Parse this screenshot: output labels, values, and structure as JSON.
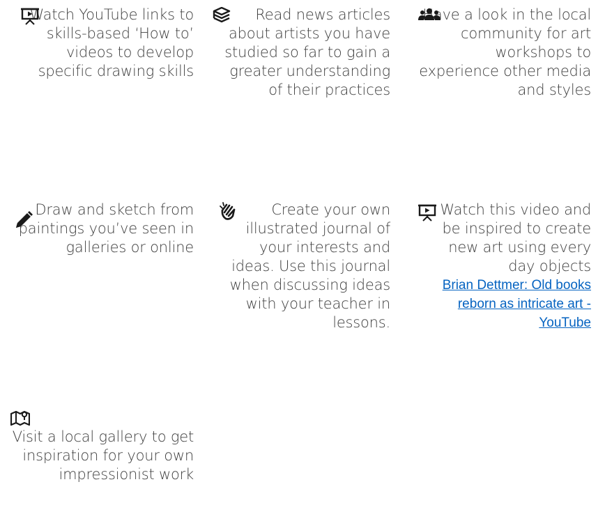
{
  "tiles": [
    {
      "icon": "presentation-screen-icon",
      "text": "Watch YouTube links to skills-based ‘How to’ videos to develop specific drawing skills"
    },
    {
      "icon": "layered-books-icon",
      "text": "Read news articles about artists you have studied so far to gain a greater understanding of their practices"
    },
    {
      "icon": "people-group-icon",
      "text": "Have a look in the local community for art workshops to experience other media and styles"
    },
    {
      "icon": "pencil-icon",
      "text": "Draw and sketch from paintings you’ve seen in galleries or online"
    },
    {
      "icon": "sign-language-hand-icon",
      "text": "Create your own illustrated journal of your interests and ideas. Use this journal when discussing ideas with your teacher in lessons."
    },
    {
      "icon": "presentation-screen-icon",
      "text": "Watch this video and be inspired to create new art using every day objects",
      "link": "Brian Dettmer: Old books reborn as intricate art - YouTube"
    },
    {
      "icon": "map-pin-icon",
      "text": "Visit a local gallery to get inspiration for your own impressionist work"
    }
  ]
}
